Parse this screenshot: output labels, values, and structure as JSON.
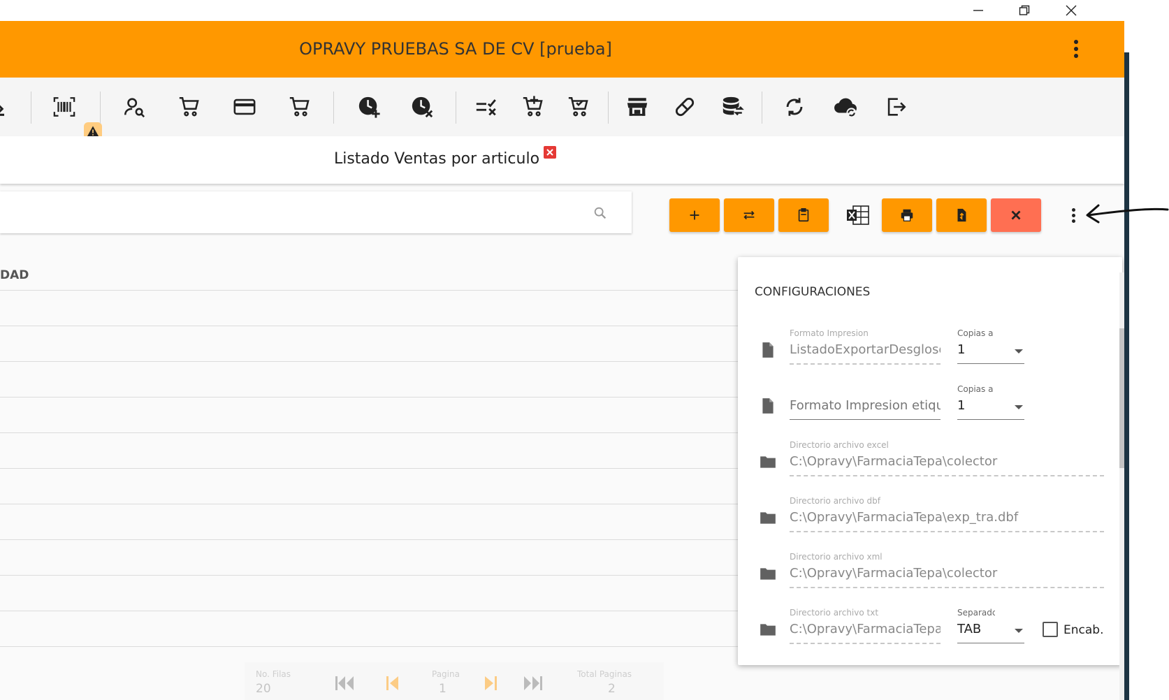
{
  "window": {
    "controls": {
      "minimize": "minimize",
      "restore": "restore",
      "close": "close"
    }
  },
  "header": {
    "title": "OPRAVY PRUEBAS SA DE CV [prueba]",
    "background": "#ff9800"
  },
  "toolbar": {
    "icons": [
      "partial-icon",
      "barcode-icon",
      "search-user-icon",
      "cart-icon",
      "credit-card-icon",
      "cart-alt-icon",
      "clock-plus-icon",
      "clock-x-icon",
      "list-check-icon",
      "cart-plus-icon",
      "cart-check-icon",
      "store-icon",
      "pill-icon",
      "database-sync-icon",
      "sync-icon",
      "cloud-sync-icon",
      "logout-icon"
    ],
    "warning_icon": "warning-icon"
  },
  "page": {
    "title": "Listado Ventas por articulo"
  },
  "search": {
    "placeholder": ""
  },
  "actions": {
    "add_label": "+",
    "buttons": [
      "add",
      "swap",
      "clipboard",
      "excel",
      "print",
      "export-file",
      "close"
    ]
  },
  "table": {
    "column_header": "DAD",
    "row_count": 10
  },
  "pager": {
    "rows_label": "No. Filas",
    "rows_value": "20",
    "page_label": "Pagina",
    "page_value": "1",
    "total_label": "Total Paginas",
    "total_value": "2"
  },
  "config": {
    "title": "CONFIGURACIONES",
    "rows": [
      {
        "icon": "file-icon",
        "label": "Formato Impresion",
        "value": "ListadoExportarDesglosesD",
        "copies_label": "Copias a",
        "copies_value": "1"
      },
      {
        "icon": "file-icon",
        "label": "",
        "value": "Formato Impresion etiquet",
        "copies_label": "Copias a",
        "copies_value": "1"
      },
      {
        "icon": "folder-icon",
        "label": "Directorio archivo excel",
        "value": "C:\\Opravy\\FarmaciaTepa\\colector"
      },
      {
        "icon": "folder-icon",
        "label": "Directorio archivo dbf",
        "value": "C:\\Opravy\\FarmaciaTepa\\exp_tra.dbf"
      },
      {
        "icon": "folder-icon",
        "label": "Directorio archivo xml",
        "value": "C:\\Opravy\\FarmaciaTepa\\colector"
      },
      {
        "icon": "folder-icon",
        "label": "Directorio archivo txt",
        "value": "C:\\Opravy\\FarmaciaTepa\\cc",
        "sep_label": "Separadc",
        "sep_value": "TAB",
        "check_label": "Encab."
      }
    ]
  }
}
